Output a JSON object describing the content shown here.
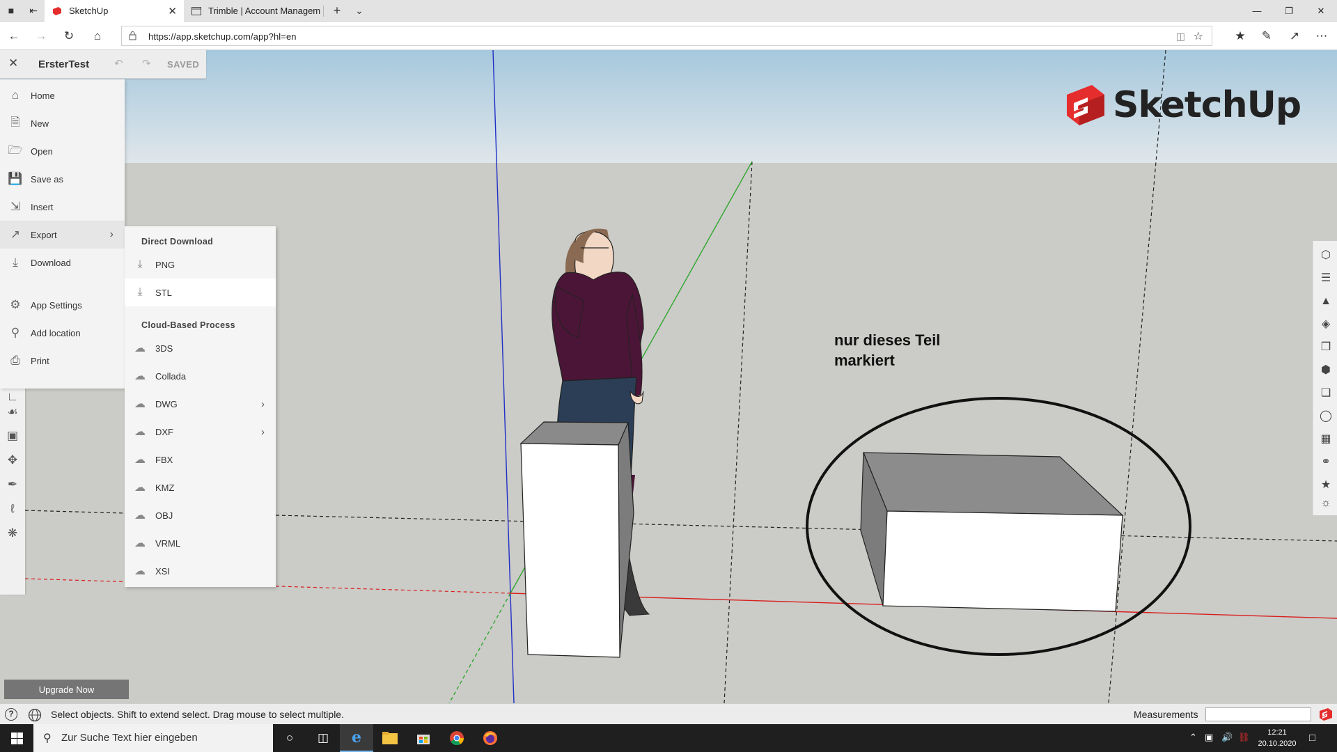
{
  "browser": {
    "tabs": [
      {
        "label": "SketchUp",
        "active": true
      },
      {
        "label": "Trimble | Account Managem",
        "active": false
      }
    ],
    "url": "https://app.sketchup.com/app?hl=en"
  },
  "app": {
    "doc_title": "ErsterTest",
    "save_status": "SAVED",
    "logo_text": "SketchUp",
    "annotation": "nur dieses Teil\nmarkiert",
    "main_menu": [
      {
        "label": "Home",
        "icon": "home-icon"
      },
      {
        "label": "New",
        "icon": "new-file-icon"
      },
      {
        "label": "Open",
        "icon": "folder-icon"
      },
      {
        "label": "Save as",
        "icon": "save-as-icon"
      },
      {
        "label": "Insert",
        "icon": "insert-icon"
      },
      {
        "label": "Export",
        "icon": "export-icon",
        "has_submenu": true
      },
      {
        "label": "Download",
        "icon": "download-icon"
      },
      {
        "label": "App Settings",
        "icon": "gear-icon"
      },
      {
        "label": "Add location",
        "icon": "location-pin-icon"
      },
      {
        "label": "Print",
        "icon": "printer-icon"
      }
    ],
    "export_menu": {
      "direct_header": "Direct Download",
      "direct_items": [
        "PNG",
        "STL"
      ],
      "cloud_header": "Cloud-Based Process",
      "cloud_items": [
        {
          "label": "3DS"
        },
        {
          "label": "Collada"
        },
        {
          "label": "DWG",
          "has_submenu": true
        },
        {
          "label": "DXF",
          "has_submenu": true
        },
        {
          "label": "FBX"
        },
        {
          "label": "KMZ"
        },
        {
          "label": "OBJ"
        },
        {
          "label": "VRML"
        },
        {
          "label": "XSI"
        }
      ]
    },
    "upgrade_label": "Upgrade Now",
    "status_text": "Select objects. Shift to extend select. Drag mouse to select multiple.",
    "measurements_label": "Measurements",
    "measurements_value": ""
  },
  "taskbar": {
    "search_placeholder": "Zur Suche Text hier eingeben",
    "time": "12:21",
    "date": "20.10.2020"
  },
  "colors": {
    "sketchup_red": "#e52d2d",
    "red_axis": "#d81e1e",
    "green_axis": "#2da82d",
    "blue_axis": "#1f2fc7"
  }
}
